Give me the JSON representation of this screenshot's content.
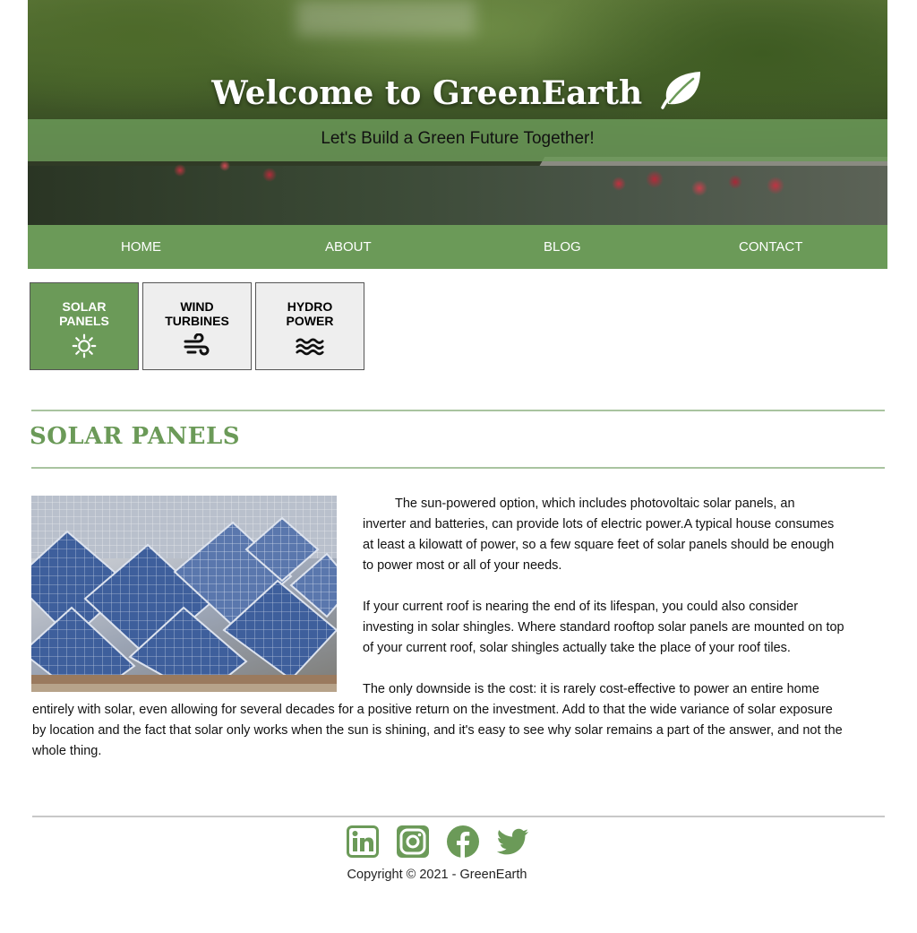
{
  "hero": {
    "title": "Welcome to GreenEarth",
    "title_icon": "leaf-icon",
    "subtitle": "Let's Build a Green Future Together!"
  },
  "nav": {
    "items": [
      {
        "label": "HOME"
      },
      {
        "label": "ABOUT"
      },
      {
        "label": "BLOG"
      },
      {
        "label": "CONTACT"
      }
    ]
  },
  "tabs": [
    {
      "line1": "SOLAR",
      "line2": "PANELS",
      "icon": "sun-icon",
      "active": true
    },
    {
      "line1": "WIND",
      "line2": "TURBINES",
      "icon": "wind-icon",
      "active": false
    },
    {
      "line1": "HYDRO",
      "line2": "POWER",
      "icon": "water-icon",
      "active": false
    }
  ],
  "section": {
    "title": "SOLAR PANELS",
    "image_alt": "solar-panels-photo",
    "paragraphs": [
      "The sun-powered option, which includes photovoltaic solar panels, an inverter and batteries, can provide lots of electric power.A typical house consumes at least a kilowatt of power, so a few square feet of solar panels should be enough to power most or all of your needs.",
      "If your current roof is nearing the end of its lifespan, you could also consider investing in solar shingles. Where standard rooftop solar panels are mounted on top of your current roof, solar shingles actually take the place of your roof tiles.",
      "The only downside is the cost: it is rarely cost-effective to power an entire home entirely with solar, even allowing for several decades for a positive return on the investment. Add to that the wide variance of solar exposure by location and the fact that solar only works when the sun is shining, and it's easy to see why solar remains a part of the answer, and not the whole thing."
    ]
  },
  "footer": {
    "social": [
      "linkedin-icon",
      "instagram-icon",
      "facebook-icon",
      "twitter-icon"
    ],
    "copyright": "Copyright © 2021 - GreenEarth"
  },
  "colors": {
    "accent": "#6b9a58",
    "rule": "#a9c4a0"
  }
}
